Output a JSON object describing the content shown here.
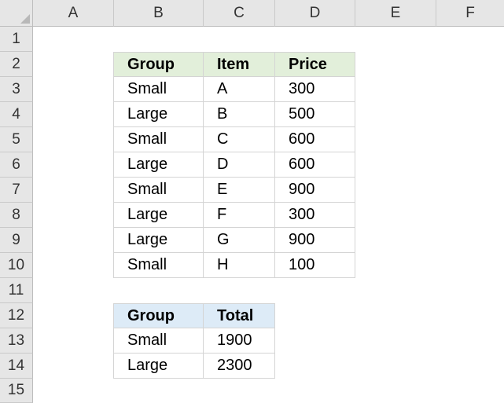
{
  "columns": [
    "A",
    "B",
    "C",
    "D",
    "E",
    "F"
  ],
  "rows": [
    "1",
    "2",
    "3",
    "4",
    "5",
    "6",
    "7",
    "8",
    "9",
    "10",
    "11",
    "12",
    "13",
    "14",
    "15"
  ],
  "table1": {
    "headers": [
      "Group",
      "Item",
      "Price"
    ],
    "rows": [
      [
        "Small",
        "A",
        "300"
      ],
      [
        "Large",
        "B",
        "500"
      ],
      [
        "Small",
        "C",
        "600"
      ],
      [
        "Large",
        "D",
        "600"
      ],
      [
        "Small",
        "E",
        "900"
      ],
      [
        "Large",
        "F",
        "300"
      ],
      [
        "Large",
        "G",
        "900"
      ],
      [
        "Small",
        "H",
        "100"
      ]
    ]
  },
  "table2": {
    "headers": [
      "Group",
      "Total"
    ],
    "rows": [
      [
        "Small",
        "1900"
      ],
      [
        "Large",
        "2300"
      ]
    ]
  },
  "colors": {
    "header_green": "#e2efda",
    "header_blue": "#ddebf7",
    "headers_bg": "#e6e6e6"
  }
}
